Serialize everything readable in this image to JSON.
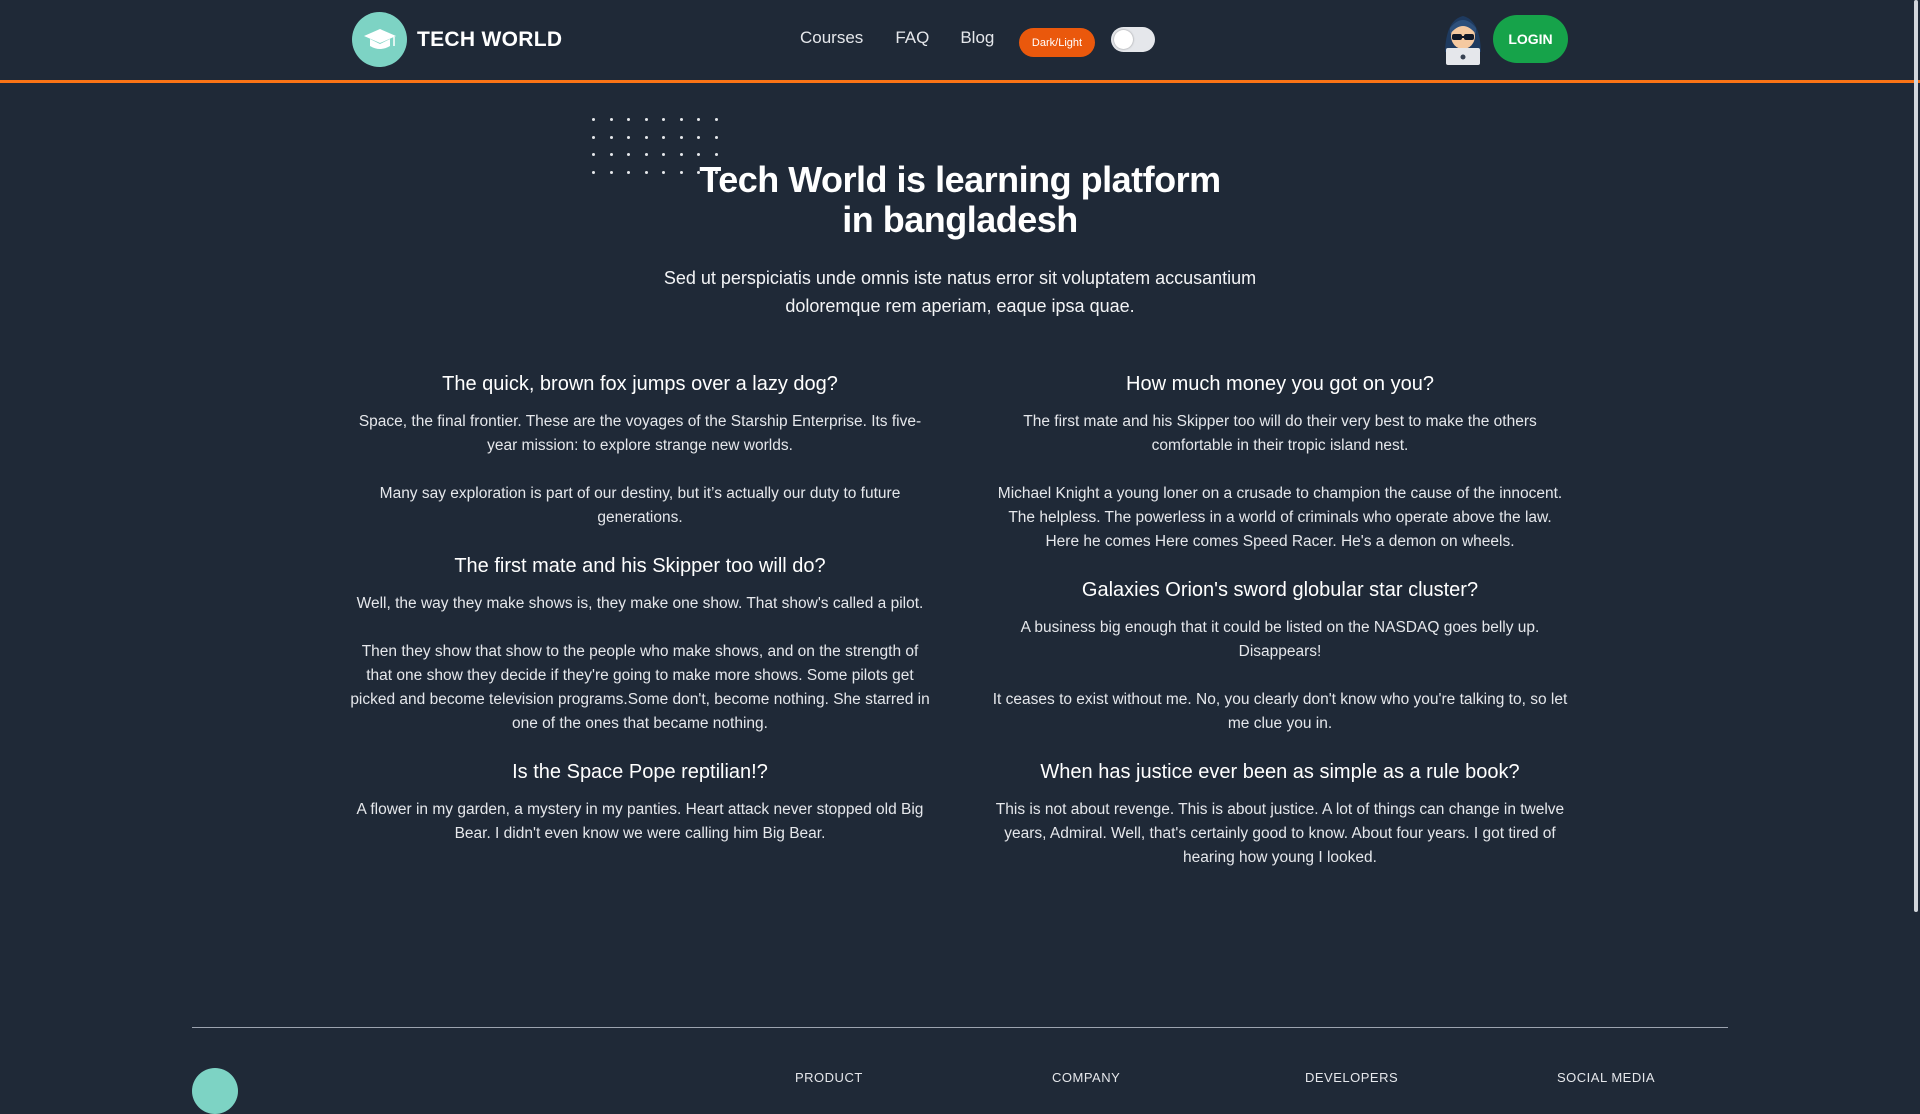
{
  "header": {
    "brand_name": "TECH WORLD",
    "logo_icon": "graduation-cap-icon",
    "nav": [
      "Courses",
      "FAQ",
      "Blog"
    ],
    "theme_button": "Dark/Light",
    "login_button": "LOGIN"
  },
  "hero": {
    "title_line1": "Tech World is learning platform",
    "title_line2": "in bangladesh",
    "subtitle_line1": "Sed ut perspiciatis unde omnis iste natus error sit voluptatem accusantium",
    "subtitle_line2": "doloremque rem aperiam, eaque ipsa quae."
  },
  "faq_left": [
    {
      "question": "The quick, brown fox jumps over a lazy dog?",
      "paragraphs": [
        "Space, the final frontier. These are the voyages of the Starship Enterprise. Its five-year mission: to explore strange new worlds.",
        "Many say exploration is part of our destiny, but it’s actually our duty to future generations."
      ]
    },
    {
      "question": "The first mate and his Skipper too will do?",
      "paragraphs": [
        "Well, the way they make shows is, they make one show. That show's called a pilot.",
        "Then they show that show to the people who make shows, and on the strength of that one show they decide if they're going to make more shows. Some pilots get picked and become television programs.Some don't, become nothing. She starred in one of the ones that became nothing."
      ]
    },
    {
      "question": "Is the Space Pope reptilian!?",
      "paragraphs": [
        "A flower in my garden, a mystery in my panties. Heart attack never stopped old Big Bear. I didn't even know we were calling him Big Bear."
      ]
    }
  ],
  "faq_right": [
    {
      "question": "How much money you got on you?",
      "paragraphs": [
        "The first mate and his Skipper too will do their very best to make the others comfortable in their tropic island nest.",
        "Michael Knight a young loner on a crusade to champion the cause of the innocent. The helpless. The powerless in a world of criminals who operate above the law. Here he comes Here comes Speed Racer. He's a demon on wheels."
      ]
    },
    {
      "question": "Galaxies Orion's sword globular star cluster?",
      "paragraphs": [
        "A business big enough that it could be listed on the NASDAQ goes belly up. Disappears!",
        "It ceases to exist without me. No, you clearly don't know who you're talking to, so let me clue you in."
      ]
    },
    {
      "question": "When has justice ever been as simple as a rule book?",
      "paragraphs": [
        "This is not about revenge. This is about justice. A lot of things can change in twelve years, Admiral. Well, that's certainly good to know. About four years. I got tired of hearing how young I looked."
      ]
    }
  ],
  "footer": {
    "columns": [
      "PRODUCT",
      "COMPANY",
      "DEVELOPERS",
      "SOCIAL MEDIA"
    ]
  },
  "colors": {
    "background": "#1f2937",
    "accent_orange": "#f97316",
    "login_green": "#16a34a",
    "logo_teal": "#7dd3c4"
  }
}
